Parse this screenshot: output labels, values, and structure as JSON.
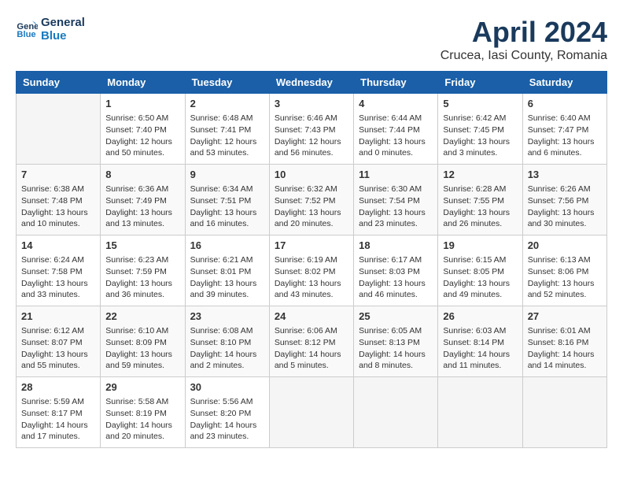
{
  "header": {
    "logo_line1": "General",
    "logo_line2": "Blue",
    "month": "April 2024",
    "location": "Crucea, Iasi County, Romania"
  },
  "weekdays": [
    "Sunday",
    "Monday",
    "Tuesday",
    "Wednesday",
    "Thursday",
    "Friday",
    "Saturday"
  ],
  "weeks": [
    [
      {
        "day": "",
        "info": ""
      },
      {
        "day": "1",
        "info": "Sunrise: 6:50 AM\nSunset: 7:40 PM\nDaylight: 12 hours\nand 50 minutes."
      },
      {
        "day": "2",
        "info": "Sunrise: 6:48 AM\nSunset: 7:41 PM\nDaylight: 12 hours\nand 53 minutes."
      },
      {
        "day": "3",
        "info": "Sunrise: 6:46 AM\nSunset: 7:43 PM\nDaylight: 12 hours\nand 56 minutes."
      },
      {
        "day": "4",
        "info": "Sunrise: 6:44 AM\nSunset: 7:44 PM\nDaylight: 13 hours\nand 0 minutes."
      },
      {
        "day": "5",
        "info": "Sunrise: 6:42 AM\nSunset: 7:45 PM\nDaylight: 13 hours\nand 3 minutes."
      },
      {
        "day": "6",
        "info": "Sunrise: 6:40 AM\nSunset: 7:47 PM\nDaylight: 13 hours\nand 6 minutes."
      }
    ],
    [
      {
        "day": "7",
        "info": "Sunrise: 6:38 AM\nSunset: 7:48 PM\nDaylight: 13 hours\nand 10 minutes."
      },
      {
        "day": "8",
        "info": "Sunrise: 6:36 AM\nSunset: 7:49 PM\nDaylight: 13 hours\nand 13 minutes."
      },
      {
        "day": "9",
        "info": "Sunrise: 6:34 AM\nSunset: 7:51 PM\nDaylight: 13 hours\nand 16 minutes."
      },
      {
        "day": "10",
        "info": "Sunrise: 6:32 AM\nSunset: 7:52 PM\nDaylight: 13 hours\nand 20 minutes."
      },
      {
        "day": "11",
        "info": "Sunrise: 6:30 AM\nSunset: 7:54 PM\nDaylight: 13 hours\nand 23 minutes."
      },
      {
        "day": "12",
        "info": "Sunrise: 6:28 AM\nSunset: 7:55 PM\nDaylight: 13 hours\nand 26 minutes."
      },
      {
        "day": "13",
        "info": "Sunrise: 6:26 AM\nSunset: 7:56 PM\nDaylight: 13 hours\nand 30 minutes."
      }
    ],
    [
      {
        "day": "14",
        "info": "Sunrise: 6:24 AM\nSunset: 7:58 PM\nDaylight: 13 hours\nand 33 minutes."
      },
      {
        "day": "15",
        "info": "Sunrise: 6:23 AM\nSunset: 7:59 PM\nDaylight: 13 hours\nand 36 minutes."
      },
      {
        "day": "16",
        "info": "Sunrise: 6:21 AM\nSunset: 8:01 PM\nDaylight: 13 hours\nand 39 minutes."
      },
      {
        "day": "17",
        "info": "Sunrise: 6:19 AM\nSunset: 8:02 PM\nDaylight: 13 hours\nand 43 minutes."
      },
      {
        "day": "18",
        "info": "Sunrise: 6:17 AM\nSunset: 8:03 PM\nDaylight: 13 hours\nand 46 minutes."
      },
      {
        "day": "19",
        "info": "Sunrise: 6:15 AM\nSunset: 8:05 PM\nDaylight: 13 hours\nand 49 minutes."
      },
      {
        "day": "20",
        "info": "Sunrise: 6:13 AM\nSunset: 8:06 PM\nDaylight: 13 hours\nand 52 minutes."
      }
    ],
    [
      {
        "day": "21",
        "info": "Sunrise: 6:12 AM\nSunset: 8:07 PM\nDaylight: 13 hours\nand 55 minutes."
      },
      {
        "day": "22",
        "info": "Sunrise: 6:10 AM\nSunset: 8:09 PM\nDaylight: 13 hours\nand 59 minutes."
      },
      {
        "day": "23",
        "info": "Sunrise: 6:08 AM\nSunset: 8:10 PM\nDaylight: 14 hours\nand 2 minutes."
      },
      {
        "day": "24",
        "info": "Sunrise: 6:06 AM\nSunset: 8:12 PM\nDaylight: 14 hours\nand 5 minutes."
      },
      {
        "day": "25",
        "info": "Sunrise: 6:05 AM\nSunset: 8:13 PM\nDaylight: 14 hours\nand 8 minutes."
      },
      {
        "day": "26",
        "info": "Sunrise: 6:03 AM\nSunset: 8:14 PM\nDaylight: 14 hours\nand 11 minutes."
      },
      {
        "day": "27",
        "info": "Sunrise: 6:01 AM\nSunset: 8:16 PM\nDaylight: 14 hours\nand 14 minutes."
      }
    ],
    [
      {
        "day": "28",
        "info": "Sunrise: 5:59 AM\nSunset: 8:17 PM\nDaylight: 14 hours\nand 17 minutes."
      },
      {
        "day": "29",
        "info": "Sunrise: 5:58 AM\nSunset: 8:19 PM\nDaylight: 14 hours\nand 20 minutes."
      },
      {
        "day": "30",
        "info": "Sunrise: 5:56 AM\nSunset: 8:20 PM\nDaylight: 14 hours\nand 23 minutes."
      },
      {
        "day": "",
        "info": ""
      },
      {
        "day": "",
        "info": ""
      },
      {
        "day": "",
        "info": ""
      },
      {
        "day": "",
        "info": ""
      }
    ]
  ]
}
